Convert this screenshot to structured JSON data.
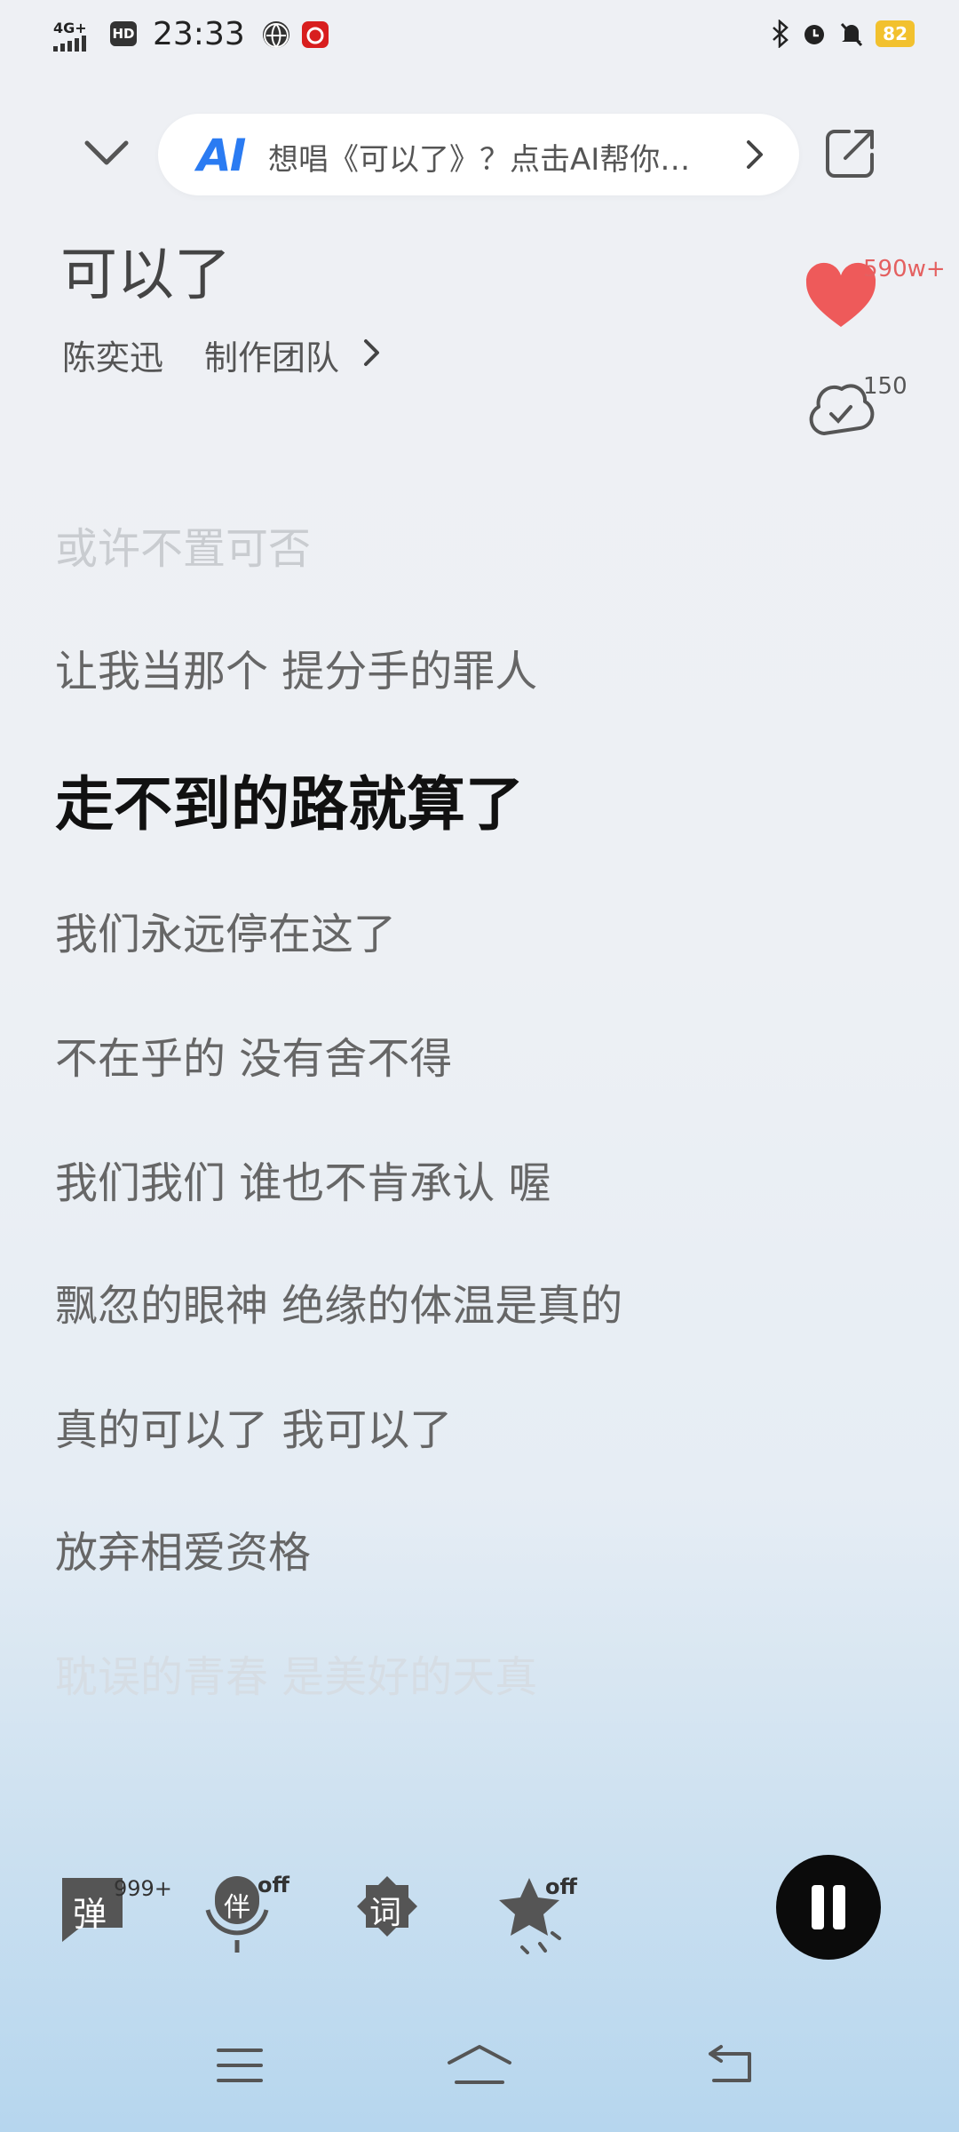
{
  "status_bar": {
    "network": "4G+",
    "hd": "HD",
    "time": "23:33",
    "battery": "82"
  },
  "header": {
    "ai_logo": "AI",
    "ai_prompt": "想唱《可以了》？点击AI帮你…"
  },
  "song": {
    "title": "可以了",
    "artist": "陈奕迅",
    "credits_label": "制作团队",
    "like_count": "590w+",
    "comment_count": "150"
  },
  "lyrics": [
    "或许不置可否",
    "让我当那个 提分手的罪人",
    "走不到的路就算了",
    "我们永远停在这了",
    "不在乎的 没有舍不得",
    "我们我们 谁也不肯承认 喔",
    "飘忽的眼神 绝缘的体温是真的",
    "真的可以了 我可以了",
    "放弃相爱资格",
    "耽误的青春 是美好的天真"
  ],
  "controls": {
    "danmaku_label": "弹",
    "danmaku_count": "999+",
    "accompany_label": "伴",
    "accompany_state": "off",
    "lyrics_label": "词",
    "effect_state": "off"
  },
  "colors": {
    "accent_like": "#ee5a5a",
    "ai_blue": "#2a7bf2",
    "active_lyric": "#111111"
  }
}
